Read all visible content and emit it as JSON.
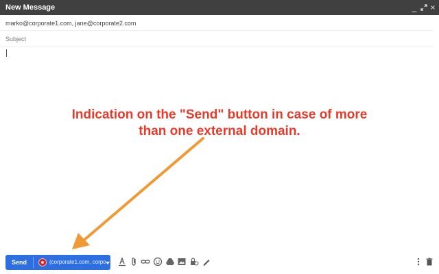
{
  "window": {
    "title": "New Message"
  },
  "fields": {
    "to_value": "marko@corporate1.com, jane@corporate2.com",
    "subject_placeholder": "Subject"
  },
  "annotation": {
    "line1": "Indication on the \"Send\" button in case of more",
    "line2": "than one external domain."
  },
  "send": {
    "label": "Send",
    "domains_text": "(corporate1.com, corporate"
  },
  "colors": {
    "titlebar": "#404040",
    "send_button": "#2d6fe0",
    "annotation": "#e83a2a",
    "arrow": "#f09a35"
  },
  "icons": {
    "toolbar": [
      "format-text-icon",
      "attach-icon",
      "link-icon",
      "emoji-icon",
      "drive-icon",
      "photo-icon",
      "confidential-icon",
      "signature-icon",
      "more-options-icon",
      "trash-icon"
    ]
  }
}
